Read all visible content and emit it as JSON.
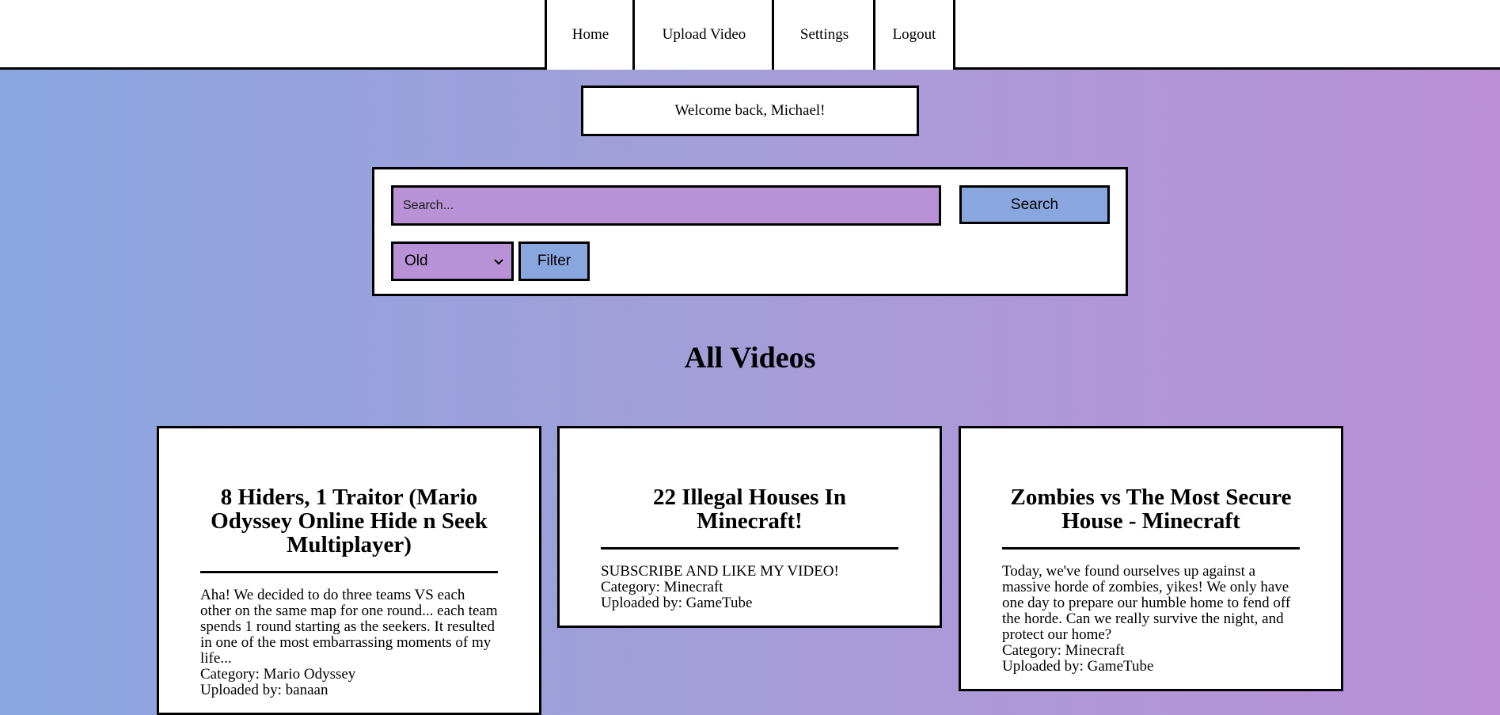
{
  "nav": {
    "items": [
      {
        "label": "Home"
      },
      {
        "label": "Upload Video"
      },
      {
        "label": "Settings"
      },
      {
        "label": "Logout"
      }
    ]
  },
  "welcome": {
    "text": "Welcome back, Michael!"
  },
  "search": {
    "placeholder": "Search...",
    "button_label": "Search",
    "sort_selected": "Old",
    "filter_label": "Filter"
  },
  "section": {
    "title": "All Videos"
  },
  "videos": [
    {
      "title": "8 Hiders, 1 Traitor (Mario Odyssey Online Hide n Seek Multiplayer)",
      "description": "Aha! We decided to do three teams VS each other on the same map for one round... each team spends 1 round starting as the seekers. It resulted in one of the most embarrassing moments of my life...",
      "category": "Category: Mario Odyssey",
      "uploader": "Uploaded by: banaan"
    },
    {
      "title": "22 Illegal Houses In Minecraft!",
      "description": "SUBSCRIBE AND LIKE MY VIDEO!",
      "category": "Category: Minecraft",
      "uploader": "Uploaded by: GameTube"
    },
    {
      "title": "Zombies vs The Most Secure House - Minecraft",
      "description": "Today, we've found ourselves up against a massive horde of zombies, yikes! We only have one day to prepare our humble home to fend off the horde. Can we really survive the night, and protect our home?",
      "category": "Category: Minecraft",
      "uploader": "Uploaded by: GameTube"
    }
  ],
  "colors": {
    "gradient_start": "#8aa6df",
    "gradient_end": "#bb8fd8",
    "input_purple": "#b891d6",
    "button_blue": "#8aa6df"
  },
  "icons": {
    "sort_dropdown": "chevron-down-icon"
  }
}
